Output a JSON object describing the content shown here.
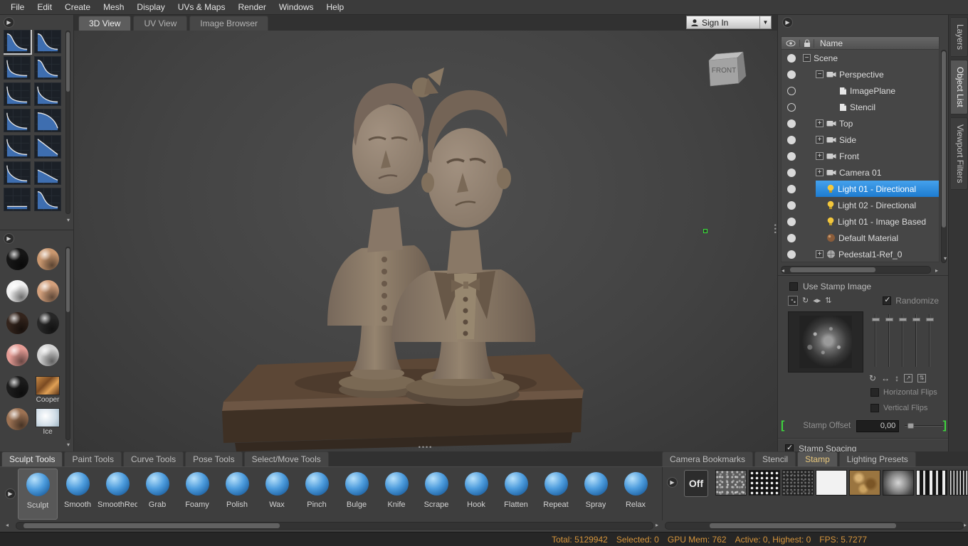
{
  "window": {
    "menu_items": [
      "File",
      "Edit",
      "Create",
      "Mesh",
      "Display",
      "UVs & Maps",
      "Render",
      "Windows",
      "Help"
    ]
  },
  "view_tabs": [
    {
      "label": "3D View",
      "selected": true
    },
    {
      "label": "UV View",
      "selected": false
    },
    {
      "label": "Image Browser",
      "selected": false
    }
  ],
  "sign_in": {
    "label": "Sign In"
  },
  "viewport": {
    "view_cube_label": "FRONT"
  },
  "left_panel": {
    "falloffs": [
      {
        "shape": "s-curve",
        "selected": true
      },
      {
        "shape": "s-curve",
        "selected": false
      },
      {
        "shape": "steep",
        "selected": false
      },
      {
        "shape": "s-curve",
        "selected": false
      },
      {
        "shape": "steep",
        "selected": false
      },
      {
        "shape": "concave",
        "selected": false
      },
      {
        "shape": "concave",
        "selected": false
      },
      {
        "shape": "convex",
        "selected": false
      },
      {
        "shape": "concave",
        "selected": false
      },
      {
        "shape": "linear",
        "selected": false
      },
      {
        "shape": "concave",
        "selected": false
      },
      {
        "shape": "shallow",
        "selected": false
      },
      {
        "shape": "flat",
        "selected": false
      },
      {
        "shape": "s-curve",
        "selected": false
      }
    ],
    "materials": [
      {
        "type": "sphere",
        "name": "black-gloss",
        "color": "#161616"
      },
      {
        "type": "sphere",
        "name": "tan-skin",
        "color": "#c9976f"
      },
      {
        "type": "sphere",
        "name": "white",
        "color": "#f1f1f1"
      },
      {
        "type": "sphere",
        "name": "skin",
        "color": "#d3a07c"
      },
      {
        "type": "sphere",
        "name": "dark-brown",
        "color": "#33241c"
      },
      {
        "type": "sphere",
        "name": "dark-gray",
        "color": "#272727"
      },
      {
        "type": "sphere",
        "name": "pink",
        "color": "#e59c95"
      },
      {
        "type": "sphere",
        "name": "silver",
        "color": "#d2d2d2"
      },
      {
        "type": "sphere",
        "name": "black",
        "color": "#1c1c1c"
      },
      {
        "type": "texture",
        "name": "cooper",
        "label": "Cooper",
        "color": "#b5763f"
      },
      {
        "type": "sphere",
        "name": "brown",
        "color": "#9c7253"
      },
      {
        "type": "texture",
        "name": "ice",
        "label": "Ice",
        "color": "#dfe8ee"
      }
    ]
  },
  "object_list": {
    "name_header": "Name",
    "rows": [
      {
        "label": "Scene",
        "level": 0,
        "expander": "minus",
        "icon": null,
        "vis": true,
        "selected": false
      },
      {
        "label": "Perspective",
        "level": 1,
        "expander": "minus",
        "icon": "camera",
        "vis": true,
        "selected": false
      },
      {
        "label": "ImagePlane",
        "level": 2,
        "expander": null,
        "icon": "plane",
        "vis": false,
        "selected": false
      },
      {
        "label": "Stencil",
        "level": 2,
        "expander": null,
        "icon": "plane",
        "vis": false,
        "selected": false
      },
      {
        "label": "Top",
        "level": 1,
        "expander": "plus",
        "icon": "camera",
        "vis": true,
        "selected": false
      },
      {
        "label": "Side",
        "level": 1,
        "expander": "plus",
        "icon": "camera",
        "vis": true,
        "selected": false
      },
      {
        "label": "Front",
        "level": 1,
        "expander": "plus",
        "icon": "camera",
        "vis": true,
        "selected": false
      },
      {
        "label": "Camera 01",
        "level": 1,
        "expander": "plus",
        "icon": "camera",
        "vis": true,
        "selected": false
      },
      {
        "label": "Light 01 - Directional",
        "level": 1,
        "expander": null,
        "icon": "bulb",
        "vis": true,
        "selected": true
      },
      {
        "label": "Light 02 - Directional",
        "level": 1,
        "expander": null,
        "icon": "bulb",
        "vis": true,
        "selected": false
      },
      {
        "label": "Light 01 - Image Based",
        "level": 1,
        "expander": null,
        "icon": "bulb",
        "vis": true,
        "selected": false
      },
      {
        "label": "Default Material",
        "level": 1,
        "expander": null,
        "icon": "material",
        "vis": true,
        "selected": false
      },
      {
        "label": "Pedestal1-Ref_0",
        "level": 1,
        "expander": "plus",
        "icon": "mesh",
        "vis": true,
        "selected": false
      }
    ]
  },
  "side_tabs": [
    {
      "label": "Layers",
      "selected": false
    },
    {
      "label": "Object List",
      "selected": true
    },
    {
      "label": "Viewport Filters",
      "selected": false
    }
  ],
  "properties": {
    "use_stamp_image": {
      "label": "Use Stamp Image",
      "checked": false
    },
    "randomize": {
      "label": "Randomize",
      "checked": true
    },
    "horizontal_flips": {
      "label": "Horizontal Flips",
      "checked": false
    },
    "vertical_flips": {
      "label": "Vertical Flips",
      "checked": false
    },
    "stamp_offset": {
      "label": "Stamp Offset",
      "value": "0,00"
    },
    "stamp_spacing": {
      "label": "Stamp Spacing",
      "checked": true
    }
  },
  "tool_tabs": [
    {
      "label": "Sculpt Tools",
      "selected": true
    },
    {
      "label": "Paint Tools",
      "selected": false
    },
    {
      "label": "Curve Tools",
      "selected": false
    },
    {
      "label": "Pose Tools",
      "selected": false
    },
    {
      "label": "Select/Move Tools",
      "selected": false
    }
  ],
  "tray_tabs": [
    {
      "label": "Camera Bookmarks",
      "selected": false
    },
    {
      "label": "Stencil",
      "selected": false
    },
    {
      "label": "Stamp",
      "selected": true
    },
    {
      "label": "Lighting Presets",
      "selected": false
    }
  ],
  "tools": [
    {
      "name": "Sculpt",
      "selected": true
    },
    {
      "name": "Smooth",
      "selected": false
    },
    {
      "name": "SmoothRed",
      "selected": false
    },
    {
      "name": "Grab",
      "selected": false
    },
    {
      "name": "Foamy",
      "selected": false
    },
    {
      "name": "Polish",
      "selected": false
    },
    {
      "name": "Wax",
      "selected": false
    },
    {
      "name": "Pinch",
      "selected": false
    },
    {
      "name": "Bulge",
      "selected": false
    },
    {
      "name": "Knife",
      "selected": false
    },
    {
      "name": "Scrape",
      "selected": false
    },
    {
      "name": "Hook",
      "selected": false
    },
    {
      "name": "Flatten",
      "selected": false
    },
    {
      "name": "Repeat",
      "selected": false
    },
    {
      "name": "Spray",
      "selected": false
    },
    {
      "name": "Relax",
      "selected": false
    }
  ],
  "stamp_tray": {
    "off_label": "Off",
    "stamps": [
      {
        "name": "gray-noise"
      },
      {
        "name": "white-dots"
      },
      {
        "name": "dark-noise"
      },
      {
        "name": "solid-white"
      },
      {
        "name": "brown-crumple"
      },
      {
        "name": "soft-blob"
      },
      {
        "name": "bw-stripes"
      },
      {
        "name": "fine-lines"
      }
    ]
  },
  "status_bar": {
    "parts": [
      "Total: 5129942",
      "Selected: 0",
      "GPU Mem: 762",
      "Active: 0, Highest: 0",
      "FPS: 5.7277"
    ]
  }
}
